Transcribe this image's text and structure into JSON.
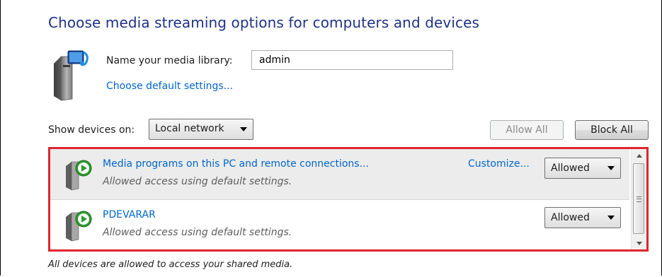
{
  "header": {
    "title": "Choose media streaming options for computers and devices"
  },
  "library": {
    "icon": "media-library-server-icon",
    "name_label": "Name your media library:",
    "name_value": "admin",
    "default_link": "Choose default settings..."
  },
  "filter": {
    "show_label": "Show devices on:",
    "network_selected": "Local network",
    "allow_all_label": "Allow All",
    "block_all_label": "Block All"
  },
  "devices": [
    {
      "icon": "media-device-play-icon",
      "name": "Media programs on this PC and remote connections...",
      "status": "Allowed access using default settings.",
      "customize_label": "Customize...",
      "access": "Allowed"
    },
    {
      "icon": "media-device-play-icon",
      "name": "PDEVARAR",
      "status": "Allowed access using default settings.",
      "access": "Allowed"
    }
  ],
  "footer": {
    "text": "All devices are allowed to access your shared media."
  },
  "colors": {
    "title": "#1e3287",
    "link": "#0066cc",
    "highlight_border": "#e0252d"
  }
}
